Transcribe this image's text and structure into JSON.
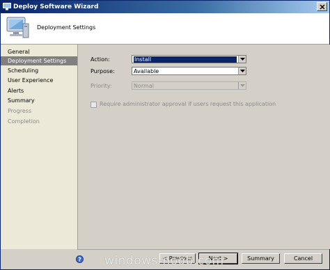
{
  "window": {
    "title": "Deploy Software Wizard"
  },
  "header": {
    "title": "Deployment Settings",
    "icon": "computer-monitor-icon"
  },
  "nav": {
    "items": [
      {
        "label": "General",
        "state": "normal"
      },
      {
        "label": "Deployment Settings",
        "state": "active"
      },
      {
        "label": "Scheduling",
        "state": "normal"
      },
      {
        "label": "User Experience",
        "state": "normal"
      },
      {
        "label": "Alerts",
        "state": "normal"
      },
      {
        "label": "Summary",
        "state": "normal"
      },
      {
        "label": "Progress",
        "state": "disabled"
      },
      {
        "label": "Completion",
        "state": "disabled"
      }
    ]
  },
  "form": {
    "action": {
      "label": "Action:",
      "value": "Install",
      "enabled": true
    },
    "purpose": {
      "label": "Purpose:",
      "value": "Available",
      "enabled": true
    },
    "priority": {
      "label": "Priority:",
      "value": "Normal",
      "enabled": false
    },
    "require_approval": {
      "label": "Require administrator approval if users request this application",
      "checked": false,
      "enabled": false
    }
  },
  "footer": {
    "previous_label": "< Previous",
    "next_label": "Next >",
    "summary_label": "Summary",
    "cancel_label": "Cancel",
    "help_icon": "help-icon"
  },
  "watermark": "windows-noob.com",
  "colors": {
    "title_bar": "#0a246a",
    "selection": "#0a246a",
    "active_nav": "#808080",
    "face": "#d4d0c8"
  }
}
